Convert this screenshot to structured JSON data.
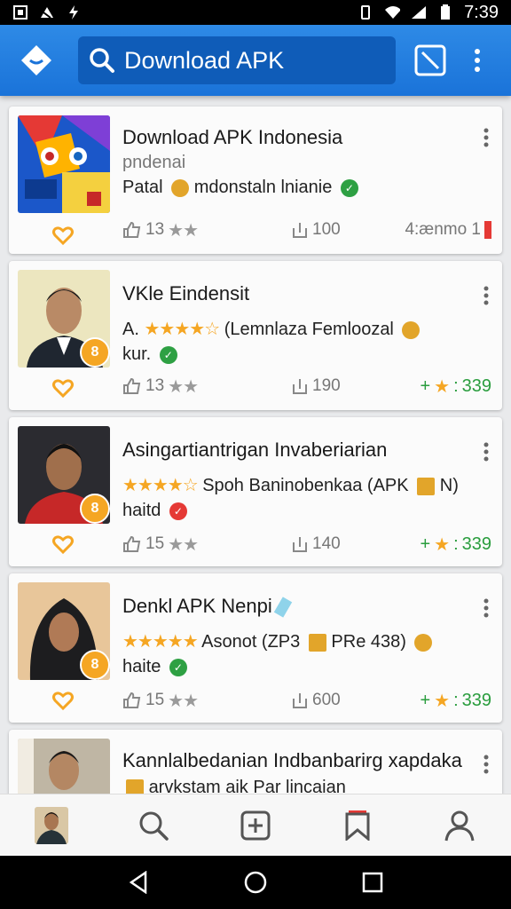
{
  "status_bar": {
    "time": "7:39"
  },
  "app_bar": {
    "search_text": "Download APK"
  },
  "cards": [
    {
      "title": "Download APK Indonesia",
      "line2": "pndenai",
      "line3": "Patal",
      "line3_tail": "mdonstaln lnianie",
      "likes": "13",
      "downloads": "100",
      "right": "4:ænmo 1"
    },
    {
      "title": "VKle Eindensit",
      "line2_prefix": "A.",
      "line2": "(Lemnlaza Femloozal",
      "line3": "kur.",
      "likes": "13",
      "downloads": "190",
      "rating": "339",
      "badge": "8"
    },
    {
      "title": "Asingartiantrigan Invaberiarian",
      "line2": "Spoh Baninobenkaa (APK",
      "line2_tail": "N)",
      "line3": "haitd",
      "likes": "15",
      "downloads": "140",
      "rating": "339",
      "badge": "8"
    },
    {
      "title": "Denkl APK Nenpi",
      "line2": "Asonot (ZP3",
      "line2_tail": "PRe 438)",
      "line3": "haite",
      "likes": "15",
      "downloads": "600",
      "rating": "339",
      "badge": "8"
    },
    {
      "title": "Kannlalbedanian Indbanbarirg xapdaka",
      "line2": "arvkstam aik Par lincaian"
    }
  ],
  "icons": {
    "brand": "#1a73d9",
    "accent": "#f5a623",
    "green": "#2a9d3e"
  }
}
